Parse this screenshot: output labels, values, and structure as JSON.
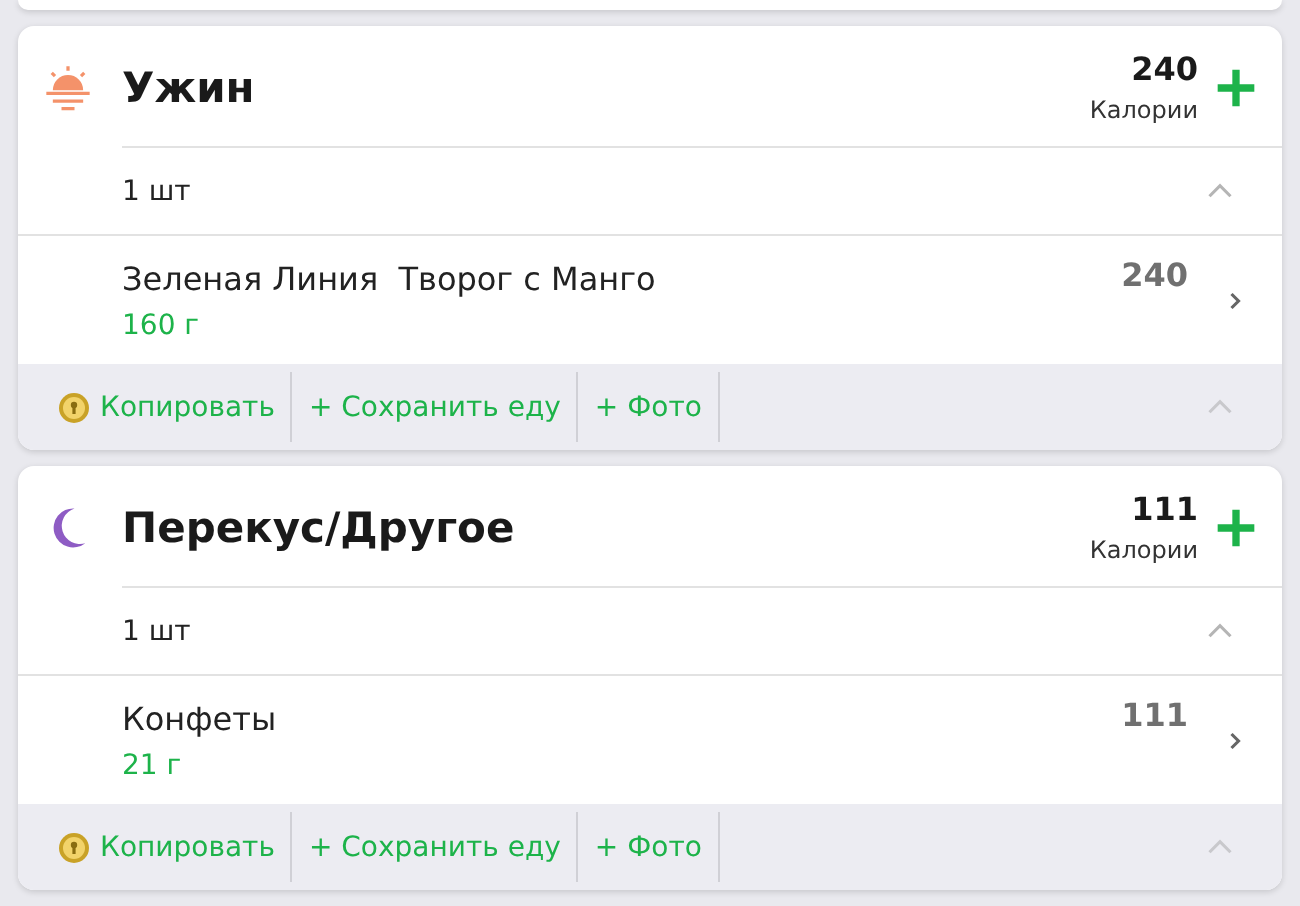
{
  "meals": [
    {
      "kind": "evening",
      "title": "Ужин",
      "calories": "240",
      "calories_label": "Калории",
      "portion": "1 шт",
      "foods": [
        {
          "name": "Зеленая Линия  Творог с Манго",
          "weight": "160 г",
          "calories": "240"
        }
      ],
      "actions": [
        "Копировать",
        "+ Сохранить еду",
        "+ Фото"
      ]
    },
    {
      "kind": "snack",
      "title": "Перекус/Другое",
      "calories": "111",
      "calories_label": "Калории",
      "portion": "1 шт",
      "foods": [
        {
          "name": "Конфеты",
          "weight": "21 г",
          "calories": "111"
        }
      ],
      "actions": [
        "Копировать",
        "+ Сохранить еду",
        "+ Фото"
      ]
    }
  ]
}
